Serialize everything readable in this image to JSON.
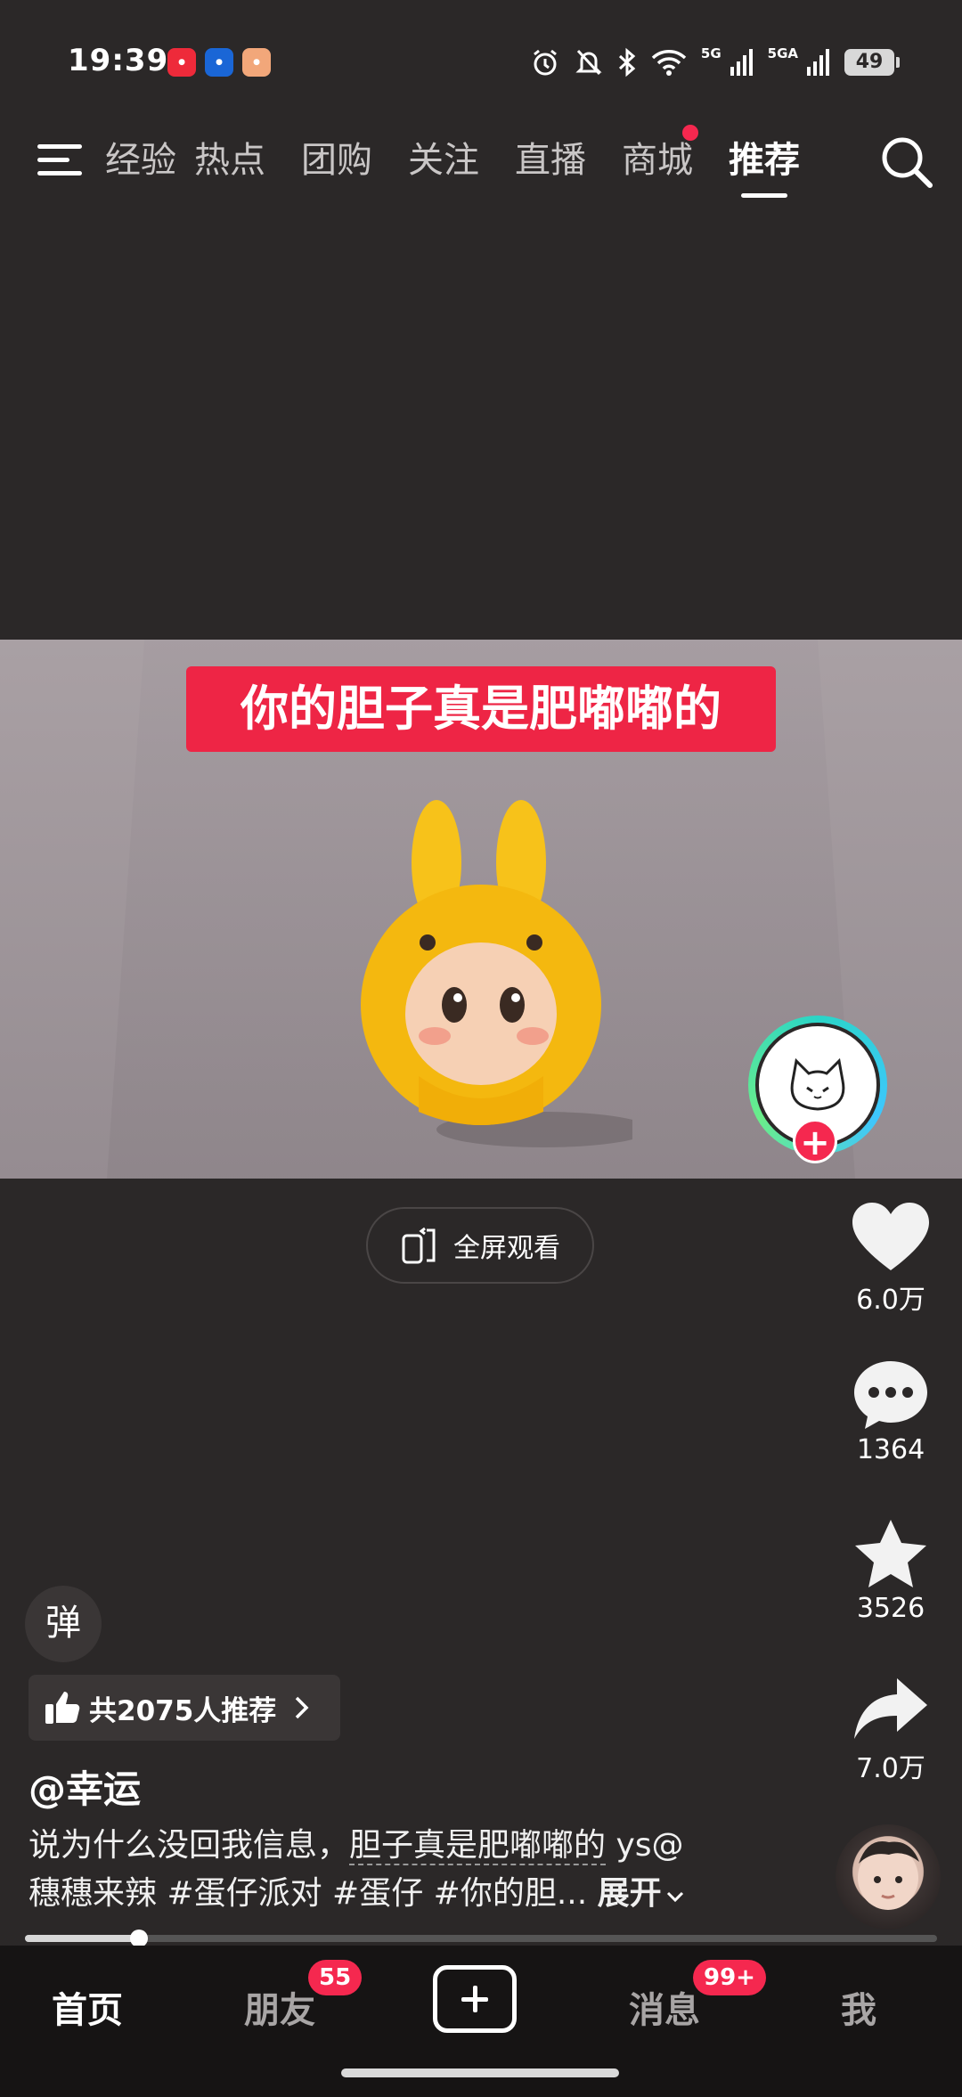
{
  "status_bar": {
    "time": "19:39",
    "battery": "49",
    "network_labels": [
      "5G",
      "5GA"
    ],
    "icons": [
      "alarm-icon",
      "mute-icon",
      "bluetooth-icon",
      "wifi-icon",
      "signal-icon",
      "battery-icon"
    ]
  },
  "top_nav": {
    "tabs": [
      "经验",
      "热点",
      "团购",
      "关注",
      "直播",
      "商城",
      "推荐"
    ],
    "active_tab": "推荐"
  },
  "video": {
    "subtitle": "你的胆子真是肥嘟嘟的",
    "fullscreen_label": "全屏观看"
  },
  "rail": {
    "likes": "6.0万",
    "comments": "1364",
    "favorites": "3526",
    "shares": "7.0万"
  },
  "info": {
    "danmu": "弹",
    "recommend": "共2075人推荐",
    "author": "@幸运",
    "desc_prefix": "说为什么没回我信息，",
    "desc_link": "胆子真是肥嘟嘟的",
    "desc_rest1": " ys@",
    "desc_line2": "穗穗来辣 #蛋仔派对 #蛋仔 #你的胆...",
    "expand": "展开"
  },
  "playback": {
    "progress": 0.125
  },
  "bottom_nav": {
    "home": "首页",
    "friends": "朋友",
    "friends_badge": "55",
    "messages": "消息",
    "messages_badge": "99+",
    "me": "我"
  },
  "colors": {
    "accent": "#f5284f",
    "subtitle_bg": "#ee2545",
    "background": "#2b2828"
  }
}
